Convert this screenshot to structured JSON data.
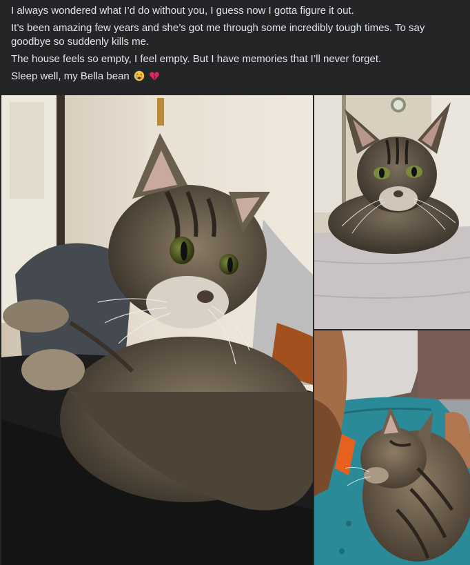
{
  "post": {
    "paragraphs": [
      "I always wondered what I’d do without you, I guess now I gotta figure it out.",
      "It’s been amazing few years and she’s got me through some incredibly tough times. To say goodbye so suddenly kills me.",
      "The house feels so empty, I feel empty. But I have memories that I’ll never forget."
    ],
    "closing": "Sleep well, my Bella bean",
    "closing_emojis": [
      "crying-face-icon",
      "broken-heart-icon"
    ]
  },
  "photos": [
    {
      "subject": "tabby-cat-on-lap"
    },
    {
      "subject": "tabby-cat-on-bed"
    },
    {
      "subject": "tabby-cat-with-person"
    }
  ],
  "colors": {
    "background": "#242526",
    "text": "#e4e6eb",
    "broken_heart": "#e0245e"
  }
}
